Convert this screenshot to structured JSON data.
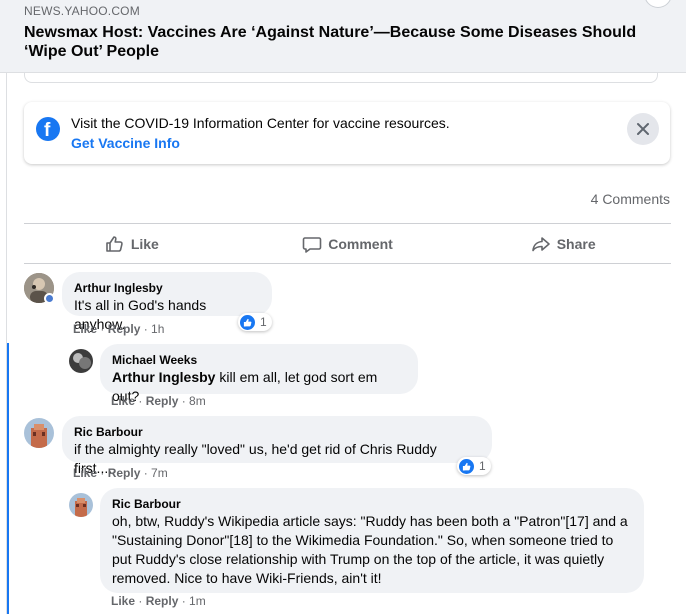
{
  "link_preview": {
    "domain": "NEWS.YAHOO.COM",
    "title": "Newsmax Host: Vaccines Are ‘Against Nature’—Because Some Diseases Should ‘Wipe Out’ People"
  },
  "covid_banner": {
    "text": "Visit the COVID-19 Information Center for vaccine resources.",
    "link": "Get Vaccine Info"
  },
  "post_stats": {
    "comments": "4 Comments"
  },
  "actions": {
    "like": "Like",
    "comment": "Comment",
    "share": "Share"
  },
  "comments": [
    {
      "author": "Arthur Inglesby",
      "text": "It's all in God's hands anyhow.",
      "like": "Like",
      "reply": "Reply",
      "time": "1h",
      "reactions": "1"
    },
    {
      "author": "Michael Weeks",
      "mention": "Arthur Inglesby",
      "text": " kill em all, let god sort em out?",
      "like": "Like",
      "reply": "Reply",
      "time": "8m"
    },
    {
      "author": "Ric Barbour",
      "text": "if the almighty really \"loved\" us, he'd get rid of Chris Ruddy first.....",
      "like": "Like",
      "reply": "Reply",
      "time": "7m",
      "reactions": "1"
    },
    {
      "author": "Ric Barbour",
      "text": "oh, btw, Ruddy's Wikipedia article says: \"Ruddy has been both a \"Patron\"[17] and a \"Sustaining Donor\"[18] to the Wikimedia Foundation.\" So, when someone tried to put Ruddy's close relationship with Trump on the top of the article, it was quietly removed. Nice to have Wiki-Friends, ain't it!",
      "like": "Like",
      "reply": "Reply",
      "time": "1m"
    }
  ],
  "separator": " · ",
  "colors": {
    "brand_blue": "#1877f2",
    "bubble_bg": "#f0f2f5",
    "secondary_text": "#65676b"
  }
}
